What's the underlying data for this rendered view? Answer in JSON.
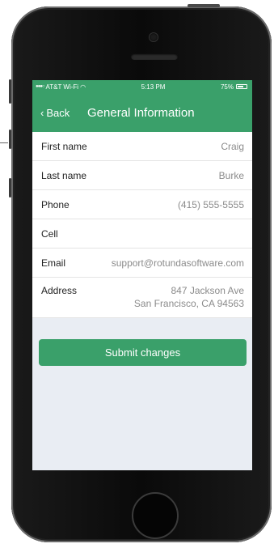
{
  "status_bar": {
    "carrier": "AT&T Wi-Fi",
    "time": "5:13 PM",
    "battery": "75%",
    "battery_level": 0.75
  },
  "nav": {
    "back_label": "Back",
    "title": "General Information"
  },
  "fields": [
    {
      "label": "First name",
      "value": "Craig"
    },
    {
      "label": "Last name",
      "value": "Burke"
    },
    {
      "label": "Phone",
      "value": "(415) 555-5555"
    },
    {
      "label": "Cell",
      "value": ""
    },
    {
      "label": "Email",
      "value": "support@rotundasoftware.com"
    }
  ],
  "address": {
    "label": "Address",
    "line1": "847 Jackson Ave",
    "line2": "San Francisco, CA 94563"
  },
  "submit_label": "Submit changes",
  "colors": {
    "accent": "#3aa06a",
    "background": "#e9edf3",
    "value_text": "#8b8b8b"
  }
}
